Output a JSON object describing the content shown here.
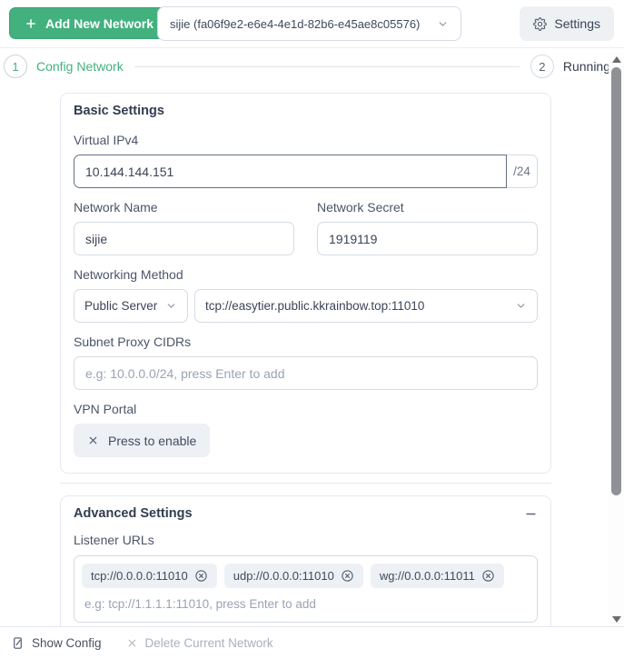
{
  "header": {
    "add_button": "Add New Network",
    "network_select": "sijie (fa06f9e2-e6e4-4e1d-82b6-e45ae8c05576)",
    "settings_button": "Settings"
  },
  "stepper": {
    "step1_number": "1",
    "step1_label": "Config Network",
    "step2_number": "2",
    "step2_label": "Running"
  },
  "basic": {
    "title": "Basic Settings",
    "virtual_ipv4": {
      "label": "Virtual IPv4",
      "value": "10.144.144.151",
      "suffix": "/24"
    },
    "network_name": {
      "label": "Network Name",
      "value": "sijie"
    },
    "network_secret": {
      "label": "Network Secret",
      "value": "1919119"
    },
    "networking_method": {
      "label": "Networking Method",
      "method_selected": "Public Server",
      "server_url_selected": "tcp://easytier.public.kkrainbow.top:11010"
    },
    "subnet_proxy": {
      "label": "Subnet Proxy CIDRs",
      "placeholder": "e.g: 10.0.0.0/24, press Enter to add"
    },
    "vpn_portal": {
      "label": "VPN Portal",
      "button_label": "Press to enable"
    }
  },
  "advanced": {
    "title": "Advanced Settings",
    "listener_urls": {
      "label": "Listener URLs",
      "chips": [
        "tcp://0.0.0.0:11010",
        "udp://0.0.0.0:11010",
        "wg://0.0.0.0:11011"
      ],
      "placeholder": "e.g: tcp://1.1.1.1:11010, press Enter to add"
    }
  },
  "footer": {
    "show_config": "Show Config",
    "delete_network": "Delete Current Network"
  },
  "icons": {
    "add": "plus",
    "network_select": "chevron-down",
    "settings": "gear",
    "vpn_portal_button": "x-mark",
    "chip_remove": "circle-x",
    "advanced_collapse": "minus",
    "show_config": "file-edit",
    "delete_network": "x-mark",
    "scrollbar": "triangle-arrows"
  },
  "colors": {
    "accent_green": "#42b17e",
    "card_border": "#e5eaf0",
    "input_border": "#d5dbe4",
    "focused_input_border": "#657083",
    "chip_bg": "#edf0f4",
    "soft_button_bg": "#edf0f5",
    "placeholder_text": "#9aa3b2",
    "scrollbar_thumb": "#8f9195"
  }
}
